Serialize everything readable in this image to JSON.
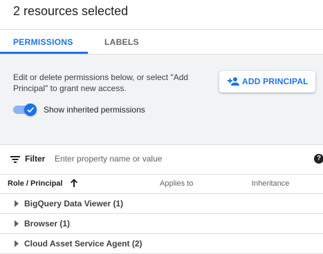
{
  "header": {
    "title": "2 resources selected"
  },
  "tabs": [
    {
      "label": "PERMISSIONS",
      "active": true
    },
    {
      "label": "LABELS",
      "active": false
    }
  ],
  "panel": {
    "description": "Edit or delete permissions below, or select \"Add Principal\" to grant new access.",
    "add_button_label": "ADD PRINCIPAL",
    "add_button_icon": "person-add-icon",
    "toggle_label": "Show inherited permissions",
    "toggle_on": true
  },
  "filter": {
    "label": "Filter",
    "placeholder": "Enter property name or value",
    "icon": "filter-list-icon",
    "help_icon": "help-icon"
  },
  "table": {
    "columns": [
      "Role / Principal",
      "Applies to",
      "Inheritance"
    ],
    "sort": "ascending",
    "rows": [
      {
        "label": "BigQuery Data Viewer (1)"
      },
      {
        "label": "Browser (1)"
      },
      {
        "label": "Cloud Asset Service Agent (2)"
      }
    ]
  },
  "colors": {
    "accent": "#1a73e8",
    "panel_bg": "#f1f3f4",
    "toggle_track": "#8ab4f8"
  }
}
